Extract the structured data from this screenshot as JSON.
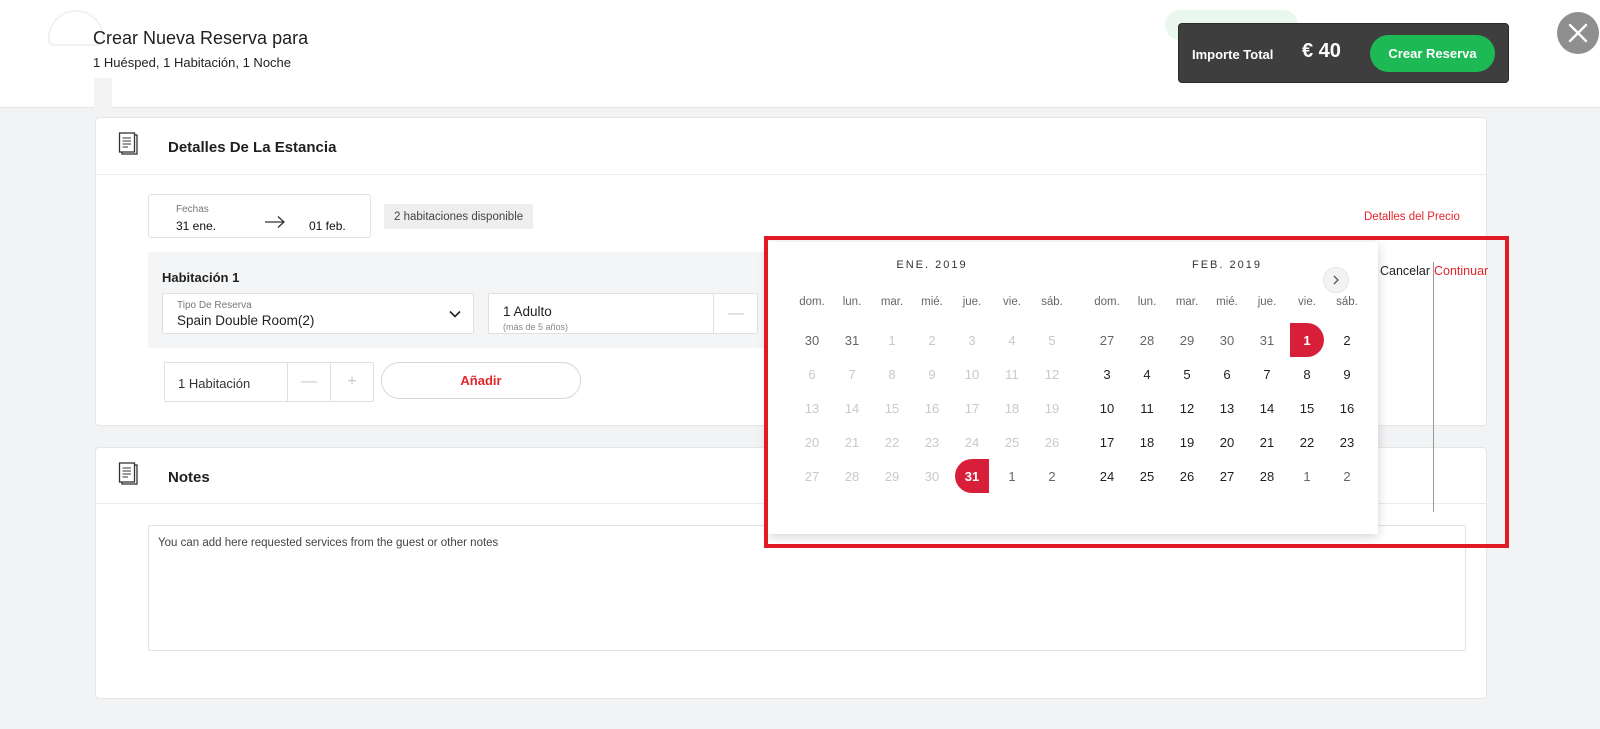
{
  "header": {
    "title": "Crear Nueva Reserva para",
    "subtitle": "1 Huésped, 1 Habitación, 1 Noche",
    "total_label": "Importe Total",
    "total_amount": "€ 40",
    "create_label": "Crear Reserva"
  },
  "stay": {
    "title": "Detalles De La Estancia",
    "dates_label": "Fechas",
    "check_in": "31 ene.",
    "check_out": "01 feb.",
    "availability": "2 habitaciones disponible",
    "price_details": "Detalles del Precio",
    "room": {
      "title": "Habitación 1",
      "type_label": "Tipo De Reserva",
      "type_value": "Spain Double Room(2)",
      "guests_value": "1 Adulto",
      "guests_note": "(más de 5 años)"
    },
    "rooms_count": "1 Habitación",
    "add_label": "Añadir"
  },
  "notes": {
    "title": "Notes",
    "placeholder": "You can add here requested services from the guest or other notes"
  },
  "calendar": {
    "weekdays": [
      "dom.",
      "lun.",
      "mar.",
      "mié.",
      "jue.",
      "vie.",
      "sáb."
    ],
    "months": [
      {
        "title": "ENE. 2019",
        "weeks": [
          [
            {
              "d": "30",
              "s": "out"
            },
            {
              "d": "31",
              "s": "out"
            },
            {
              "d": "1",
              "s": "dim"
            },
            {
              "d": "2",
              "s": "dim"
            },
            {
              "d": "3",
              "s": "dim"
            },
            {
              "d": "4",
              "s": "dim"
            },
            {
              "d": "5",
              "s": "dim"
            }
          ],
          [
            {
              "d": "6",
              "s": "dim"
            },
            {
              "d": "7",
              "s": "dim"
            },
            {
              "d": "8",
              "s": "dim"
            },
            {
              "d": "9",
              "s": "dim"
            },
            {
              "d": "10",
              "s": "dim"
            },
            {
              "d": "11",
              "s": "dim"
            },
            {
              "d": "12",
              "s": "dim"
            }
          ],
          [
            {
              "d": "13",
              "s": "dim"
            },
            {
              "d": "14",
              "s": "dim"
            },
            {
              "d": "15",
              "s": "dim"
            },
            {
              "d": "16",
              "s": "dim"
            },
            {
              "d": "17",
              "s": "dim"
            },
            {
              "d": "18",
              "s": "dim"
            },
            {
              "d": "19",
              "s": "dim"
            }
          ],
          [
            {
              "d": "20",
              "s": "dim"
            },
            {
              "d": "21",
              "s": "dim"
            },
            {
              "d": "22",
              "s": "dim"
            },
            {
              "d": "23",
              "s": "dim"
            },
            {
              "d": "24",
              "s": "dim"
            },
            {
              "d": "25",
              "s": "dim"
            },
            {
              "d": "26",
              "s": "dim"
            }
          ],
          [
            {
              "d": "27",
              "s": "dim"
            },
            {
              "d": "28",
              "s": "dim"
            },
            {
              "d": "29",
              "s": "dim"
            },
            {
              "d": "30",
              "s": "dim"
            },
            {
              "d": "31",
              "s": "sel-start"
            },
            {
              "d": "1",
              "s": "out"
            },
            {
              "d": "2",
              "s": "out"
            }
          ]
        ]
      },
      {
        "title": "FEB. 2019",
        "weeks": [
          [
            {
              "d": "27",
              "s": "out"
            },
            {
              "d": "28",
              "s": "out"
            },
            {
              "d": "29",
              "s": "out"
            },
            {
              "d": "30",
              "s": "out"
            },
            {
              "d": "31",
              "s": "out"
            },
            {
              "d": "1",
              "s": "sel-end"
            },
            {
              "d": "2",
              "s": "cur"
            }
          ],
          [
            {
              "d": "3",
              "s": "cur"
            },
            {
              "d": "4",
              "s": "cur"
            },
            {
              "d": "5",
              "s": "cur"
            },
            {
              "d": "6",
              "s": "cur"
            },
            {
              "d": "7",
              "s": "cur"
            },
            {
              "d": "8",
              "s": "cur"
            },
            {
              "d": "9",
              "s": "cur"
            }
          ],
          [
            {
              "d": "10",
              "s": "cur"
            },
            {
              "d": "11",
              "s": "cur"
            },
            {
              "d": "12",
              "s": "cur"
            },
            {
              "d": "13",
              "s": "cur"
            },
            {
              "d": "14",
              "s": "cur"
            },
            {
              "d": "15",
              "s": "cur"
            },
            {
              "d": "16",
              "s": "cur"
            }
          ],
          [
            {
              "d": "17",
              "s": "cur"
            },
            {
              "d": "18",
              "s": "cur"
            },
            {
              "d": "19",
              "s": "cur"
            },
            {
              "d": "20",
              "s": "cur"
            },
            {
              "d": "21",
              "s": "cur"
            },
            {
              "d": "22",
              "s": "cur"
            },
            {
              "d": "23",
              "s": "cur"
            }
          ],
          [
            {
              "d": "24",
              "s": "cur"
            },
            {
              "d": "25",
              "s": "cur"
            },
            {
              "d": "26",
              "s": "cur"
            },
            {
              "d": "27",
              "s": "cur"
            },
            {
              "d": "28",
              "s": "cur"
            },
            {
              "d": "1",
              "s": "out"
            },
            {
              "d": "2",
              "s": "out"
            }
          ]
        ]
      }
    ],
    "cancel_label": "Cancelar",
    "continue_label": "Continuar"
  },
  "colors": {
    "accent_red": "#e3262b",
    "selection_red": "#d71f3a",
    "create_green": "#1db954",
    "total_box": "#3e3e3e",
    "highlight_border": "#e11b23"
  }
}
